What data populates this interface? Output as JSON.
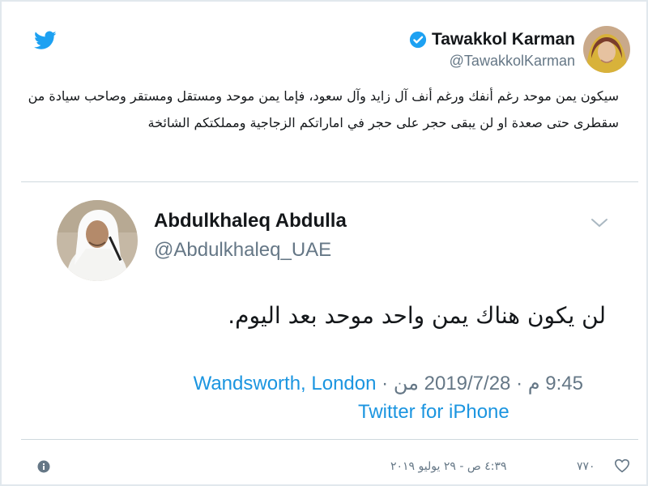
{
  "tweet": {
    "author_name": "Tawakkol Karman",
    "author_handle": "@TawakkolKarman",
    "verified": true,
    "text": "سيكون يمن موحد رغم أنفك ورغم أنف آل زايد وآل سعود، فإما يمن موحد ومستقل ومستقر وصاحب سيادة من سقطرى حتى صعدة او لن يبقى حجر على حجر في اماراتكم الزجاجية ومملكتكم الشائخة",
    "date": "٤:٣٩ ص - ٢٩ يوليو ٢٠١٩",
    "likes": "٧٧٠"
  },
  "quoted_tweet": {
    "author_name": "Abdulkhaleq Abdulla",
    "author_handle": "@Abdulkhaleq_UAE",
    "text": "لن يكون هناك يمن واحد موحد بعد اليوم.",
    "time": "9:45 م",
    "separator": "·",
    "date": "2019/7/28",
    "from_label": "من",
    "location": "Wandsworth, London",
    "source": "Twitter for iPhone"
  },
  "icons": {
    "brand": "twitter-bird-icon",
    "verified": "verified-badge-icon",
    "menu": "chevron-down-icon",
    "info": "info-icon",
    "like": "heart-icon"
  },
  "colors": {
    "twitter_blue": "#1da1f2",
    "link_blue": "#1b95e0",
    "text": "#14171a",
    "muted": "#657786"
  }
}
